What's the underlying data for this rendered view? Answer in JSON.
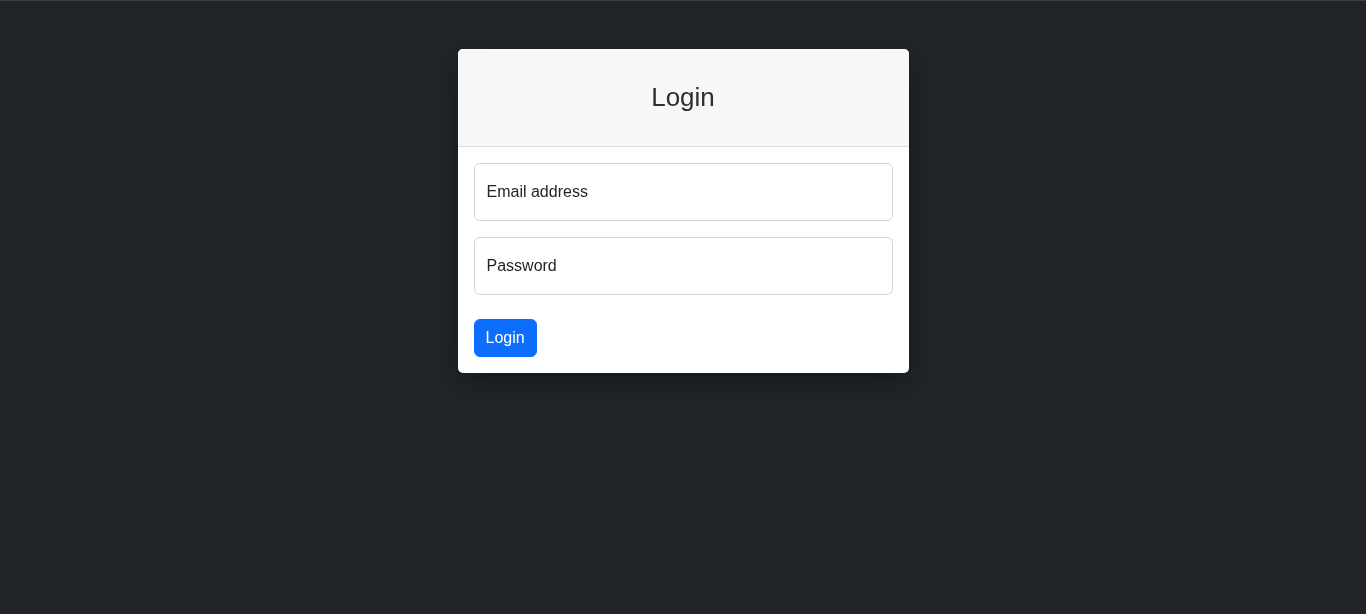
{
  "card": {
    "title": "Login"
  },
  "fields": [
    {
      "placeholder": "Email address"
    },
    {
      "placeholder": "Password"
    }
  ],
  "buttons": [
    {
      "label": "Login"
    }
  ]
}
